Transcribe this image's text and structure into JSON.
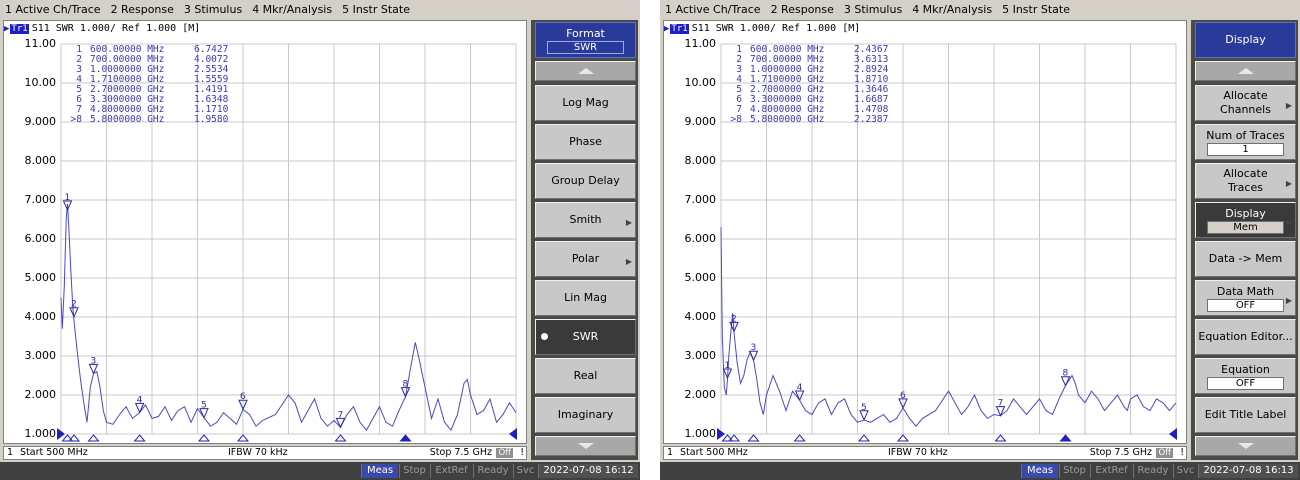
{
  "menu": [
    "1 Active Ch/Trace",
    "2 Response",
    "3 Stimulus",
    "4 Mkr/Analysis",
    "5 Instr State"
  ],
  "colors": {
    "trace": "#4848d0",
    "marker": "#2828a0",
    "grid": "#c8c8c8",
    "meas": "#3a4aa8"
  },
  "panels": [
    {
      "channel": {
        "num": "1",
        "trace": "Tr1",
        "label": "S11  SWR 1.000/ Ref 1.000 [M]"
      },
      "y_labels": [
        "11.00",
        "10.00",
        "9.000",
        "8.000",
        "7.000",
        "6.000",
        "5.000",
        "4.000",
        "3.000",
        "2.000",
        "1.000"
      ],
      "markers": [
        {
          "num": "1",
          "freq": "600.00000 MHz",
          "value": "6.7427"
        },
        {
          "num": "2",
          "freq": "700.00000 MHz",
          "value": "4.0072"
        },
        {
          "num": "3",
          "freq": "1.0000000 GHz",
          "value": "2.5534"
        },
        {
          "num": "4",
          "freq": "1.7100000 GHz",
          "value": "1.5559"
        },
        {
          "num": "5",
          "freq": "2.7000000 GHz",
          "value": "1.4191"
        },
        {
          "num": "6",
          "freq": "3.3000000 GHz",
          "value": "1.6348"
        },
        {
          "num": "7",
          "freq": "4.8000000 GHz",
          "value": "1.1710"
        },
        {
          "num": ">8",
          "freq": "5.8000000 GHz",
          "value": "1.9580"
        }
      ],
      "status": {
        "ch": "1",
        "start": "Start 500 MHz",
        "ifbw": "IFBW 70 kHz",
        "stop": "Stop 7.5 GHz",
        "off": "Off",
        "bang": "!"
      },
      "bottom": {
        "meas": "Meas",
        "stop": "Stop",
        "extref": "ExtRef",
        "ready": "Ready",
        "svc": "Svc",
        "datetime": "2022-07-08 16:12"
      },
      "softkeys": [
        {
          "label": "Format",
          "value": "SWR",
          "style": "hdr"
        },
        {
          "label": "",
          "style": "arrow-up"
        },
        {
          "label": "Log Mag"
        },
        {
          "label": "Phase"
        },
        {
          "label": "Group Delay"
        },
        {
          "label": "Smith",
          "sub": "▶"
        },
        {
          "label": "Polar",
          "sub": "▶"
        },
        {
          "label": "Lin Mag"
        },
        {
          "label": "SWR",
          "style": "dark",
          "radio": true
        },
        {
          "label": "Real"
        },
        {
          "label": "Imaginary"
        },
        {
          "label": "",
          "style": "arrow-down"
        }
      ],
      "chart_data": {
        "type": "line",
        "xlabel": "",
        "ylabel": "",
        "xlim": [
          0.5,
          7.5
        ],
        "ylim": [
          1,
          11
        ],
        "series": [
          {
            "points": [
              [
                0.5,
                4.5
              ],
              [
                0.52,
                3.7
              ],
              [
                0.55,
                4.8
              ],
              [
                0.58,
                6.5
              ],
              [
                0.6,
                6.9
              ],
              [
                0.62,
                6.3
              ],
              [
                0.65,
                5.2
              ],
              [
                0.68,
                4.3
              ],
              [
                0.7,
                3.9
              ],
              [
                0.75,
                3.1
              ],
              [
                0.8,
                2.4
              ],
              [
                0.85,
                1.8
              ],
              [
                0.9,
                1.3
              ],
              [
                0.95,
                2.2
              ],
              [
                1.0,
                2.55
              ],
              [
                1.05,
                2.6
              ],
              [
                1.1,
                2.2
              ],
              [
                1.15,
                1.6
              ],
              [
                1.2,
                1.3
              ],
              [
                1.3,
                1.25
              ],
              [
                1.4,
                1.5
              ],
              [
                1.5,
                1.7
              ],
              [
                1.6,
                1.4
              ],
              [
                1.71,
                1.55
              ],
              [
                1.8,
                1.75
              ],
              [
                1.9,
                1.4
              ],
              [
                2.0,
                1.45
              ],
              [
                2.1,
                1.7
              ],
              [
                2.2,
                1.35
              ],
              [
                2.3,
                1.6
              ],
              [
                2.4,
                1.7
              ],
              [
                2.5,
                1.3
              ],
              [
                2.6,
                1.65
              ],
              [
                2.7,
                1.42
              ],
              [
                2.8,
                1.2
              ],
              [
                2.9,
                1.3
              ],
              [
                3.0,
                1.55
              ],
              [
                3.1,
                1.4
              ],
              [
                3.2,
                1.25
              ],
              [
                3.3,
                1.63
              ],
              [
                3.4,
                1.5
              ],
              [
                3.5,
                1.2
              ],
              [
                3.6,
                1.35
              ],
              [
                3.8,
                1.5
              ],
              [
                4.0,
                2.0
              ],
              [
                4.1,
                1.8
              ],
              [
                4.2,
                1.3
              ],
              [
                4.3,
                1.6
              ],
              [
                4.4,
                1.9
              ],
              [
                4.5,
                1.4
              ],
              [
                4.6,
                1.2
              ],
              [
                4.7,
                1.35
              ],
              [
                4.8,
                1.17
              ],
              [
                4.9,
                1.5
              ],
              [
                5.0,
                1.7
              ],
              [
                5.1,
                1.3
              ],
              [
                5.2,
                1.1
              ],
              [
                5.3,
                1.4
              ],
              [
                5.4,
                1.7
              ],
              [
                5.5,
                1.3
              ],
              [
                5.6,
                1.2
              ],
              [
                5.7,
                1.6
              ],
              [
                5.8,
                1.96
              ],
              [
                5.9,
                2.9
              ],
              [
                5.95,
                3.35
              ],
              [
                6.0,
                3.0
              ],
              [
                6.1,
                2.2
              ],
              [
                6.2,
                1.4
              ],
              [
                6.3,
                1.9
              ],
              [
                6.4,
                1.3
              ],
              [
                6.5,
                1.1
              ],
              [
                6.6,
                1.5
              ],
              [
                6.7,
                2.3
              ],
              [
                6.75,
                2.4
              ],
              [
                6.8,
                2.0
              ],
              [
                6.9,
                1.5
              ],
              [
                7.0,
                1.6
              ],
              [
                7.1,
                1.9
              ],
              [
                7.2,
                1.3
              ],
              [
                7.3,
                1.5
              ],
              [
                7.4,
                1.8
              ],
              [
                7.5,
                1.55
              ]
            ]
          }
        ],
        "markers": [
          [
            0.6,
            6.7427
          ],
          [
            0.7,
            4.0072
          ],
          [
            1.0,
            2.5534
          ],
          [
            1.71,
            1.5559
          ],
          [
            2.7,
            1.4191
          ],
          [
            3.3,
            1.6348
          ],
          [
            4.8,
            1.171
          ],
          [
            5.8,
            1.958
          ]
        ]
      }
    },
    {
      "channel": {
        "num": "1",
        "trace": "Tr1",
        "label": "S11  SWR 1.000/ Ref 1.000 [M]"
      },
      "y_labels": [
        "11.00",
        "10.00",
        "9.000",
        "8.000",
        "7.000",
        "6.000",
        "5.000",
        "4.000",
        "3.000",
        "2.000",
        "1.000"
      ],
      "markers": [
        {
          "num": "1",
          "freq": "600.00000 MHz",
          "value": "2.4367"
        },
        {
          "num": "2",
          "freq": "700.00000 MHz",
          "value": "3.6313"
        },
        {
          "num": "3",
          "freq": "1.0000000 GHz",
          "value": "2.8924"
        },
        {
          "num": "4",
          "freq": "1.7100000 GHz",
          "value": "1.8710"
        },
        {
          "num": "5",
          "freq": "2.7000000 GHz",
          "value": "1.3646"
        },
        {
          "num": "6",
          "freq": "3.3000000 GHz",
          "value": "1.6687"
        },
        {
          "num": "7",
          "freq": "4.8000000 GHz",
          "value": "1.4708"
        },
        {
          "num": ">8",
          "freq": "5.8000000 GHz",
          "value": "2.2387"
        }
      ],
      "status": {
        "ch": "1",
        "start": "Start 500 MHz",
        "ifbw": "IFBW 70 kHz",
        "stop": "Stop 7.5 GHz",
        "off": "Off",
        "bang": "!"
      },
      "bottom": {
        "meas": "Meas",
        "stop": "Stop",
        "extref": "ExtRef",
        "ready": "Ready",
        "svc": "Svc",
        "datetime": "2022-07-08 16:13"
      },
      "softkeys": [
        {
          "label": "Display",
          "style": "hdr"
        },
        {
          "label": "",
          "style": "arrow-up"
        },
        {
          "label": "Allocate\nChannels",
          "sub": "▶"
        },
        {
          "label": "Num of Traces",
          "value": "1"
        },
        {
          "label": "Allocate\nTraces",
          "sub": "▶"
        },
        {
          "label": "Display",
          "value": "Mem",
          "style": "dark",
          "sub": "▶"
        },
        {
          "label": "Data -> Mem"
        },
        {
          "label": "Data Math",
          "value": "OFF",
          "sub": "▶"
        },
        {
          "label": "Equation Editor..."
        },
        {
          "label": "Equation",
          "value": "OFF"
        },
        {
          "label": "Edit Title Label"
        },
        {
          "label": "",
          "style": "arrow-down"
        }
      ],
      "chart_data": {
        "type": "line",
        "xlabel": "",
        "ylabel": "",
        "xlim": [
          0.5,
          7.5
        ],
        "ylim": [
          1,
          11
        ],
        "series": [
          {
            "points": [
              [
                0.5,
                6.3
              ],
              [
                0.52,
                3.5
              ],
              [
                0.55,
                2.2
              ],
              [
                0.58,
                2.0
              ],
              [
                0.6,
                2.4
              ],
              [
                0.62,
                3.0
              ],
              [
                0.65,
                3.6
              ],
              [
                0.68,
                4.1
              ],
              [
                0.7,
                3.6
              ],
              [
                0.75,
                2.8
              ],
              [
                0.8,
                2.3
              ],
              [
                0.85,
                2.5
              ],
              [
                0.9,
                2.9
              ],
              [
                0.95,
                3.1
              ],
              [
                1.0,
                2.9
              ],
              [
                1.05,
                2.4
              ],
              [
                1.1,
                1.8
              ],
              [
                1.15,
                1.5
              ],
              [
                1.2,
                2.0
              ],
              [
                1.3,
                2.5
              ],
              [
                1.4,
                2.1
              ],
              [
                1.5,
                1.6
              ],
              [
                1.6,
                2.1
              ],
              [
                1.71,
                1.87
              ],
              [
                1.8,
                1.6
              ],
              [
                1.9,
                1.5
              ],
              [
                2.0,
                1.8
              ],
              [
                2.1,
                1.9
              ],
              [
                2.2,
                1.5
              ],
              [
                2.3,
                1.8
              ],
              [
                2.4,
                1.9
              ],
              [
                2.5,
                1.5
              ],
              [
                2.6,
                1.3
              ],
              [
                2.7,
                1.36
              ],
              [
                2.8,
                1.3
              ],
              [
                2.9,
                1.4
              ],
              [
                3.0,
                1.5
              ],
              [
                3.1,
                1.3
              ],
              [
                3.2,
                1.4
              ],
              [
                3.3,
                1.67
              ],
              [
                3.4,
                1.4
              ],
              [
                3.5,
                1.2
              ],
              [
                3.6,
                1.4
              ],
              [
                3.8,
                1.6
              ],
              [
                4.0,
                2.1
              ],
              [
                4.1,
                1.8
              ],
              [
                4.2,
                1.5
              ],
              [
                4.3,
                1.7
              ],
              [
                4.4,
                2.0
              ],
              [
                4.5,
                1.6
              ],
              [
                4.6,
                1.4
              ],
              [
                4.7,
                1.5
              ],
              [
                4.8,
                1.47
              ],
              [
                4.9,
                1.6
              ],
              [
                5.0,
                1.9
              ],
              [
                5.1,
                1.7
              ],
              [
                5.2,
                1.5
              ],
              [
                5.3,
                1.7
              ],
              [
                5.4,
                1.9
              ],
              [
                5.5,
                1.6
              ],
              [
                5.6,
                1.5
              ],
              [
                5.7,
                1.9
              ],
              [
                5.8,
                2.24
              ],
              [
                5.9,
                2.5
              ],
              [
                5.95,
                2.3
              ],
              [
                6.0,
                2.0
              ],
              [
                6.1,
                1.8
              ],
              [
                6.2,
                2.1
              ],
              [
                6.3,
                1.9
              ],
              [
                6.4,
                1.6
              ],
              [
                6.5,
                1.8
              ],
              [
                6.6,
                2.0
              ],
              [
                6.7,
                1.7
              ],
              [
                6.75,
                1.6
              ],
              [
                6.8,
                1.9
              ],
              [
                6.9,
                2.0
              ],
              [
                7.0,
                1.7
              ],
              [
                7.1,
                1.6
              ],
              [
                7.2,
                1.9
              ],
              [
                7.3,
                1.8
              ],
              [
                7.4,
                1.6
              ],
              [
                7.5,
                1.8
              ]
            ]
          }
        ],
        "markers": [
          [
            0.6,
            2.4367
          ],
          [
            0.7,
            3.6313
          ],
          [
            1.0,
            2.8924
          ],
          [
            1.71,
            1.871
          ],
          [
            2.7,
            1.3646
          ],
          [
            3.3,
            1.6687
          ],
          [
            4.8,
            1.4708
          ],
          [
            5.8,
            2.2387
          ]
        ]
      }
    }
  ]
}
